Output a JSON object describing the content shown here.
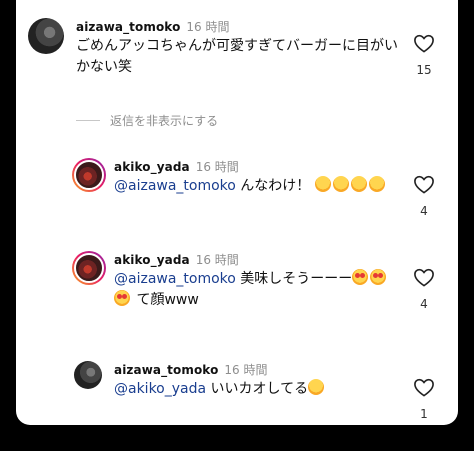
{
  "comments": [
    {
      "user": "aizawa_tomoko",
      "time": "16 時間",
      "text_line1": "ごめんアッコちゃんが可愛すぎてバーガーに目がい",
      "text_line2": "かない笑",
      "likes": "15"
    }
  ],
  "hide_replies_label": "返信を非表示にする",
  "replies": [
    {
      "user": "akiko_yada",
      "time": "16 時間",
      "mention": "@aizawa_tomoko",
      "text": " んなわけ！",
      "emoji": [
        "rofl",
        "rofl",
        "rofl",
        "rofl"
      ],
      "likes": "4"
    },
    {
      "user": "akiko_yada",
      "time": "16 時間",
      "mention": "@aizawa_tomoko",
      "text": " 美味しそうーーー",
      "text_line2": " て顔www",
      "emoji": [
        "heart-eyes",
        "heart-eyes"
      ],
      "likes": "4"
    },
    {
      "user": "aizawa_tomoko",
      "time": "16 時間",
      "mention": "@akiko_yada",
      "text": " いいカオしてる",
      "emoji": [
        "joy"
      ],
      "likes": "1"
    }
  ],
  "colors": {
    "mention": "#1a3e8f",
    "muted": "#8e8e8e"
  }
}
